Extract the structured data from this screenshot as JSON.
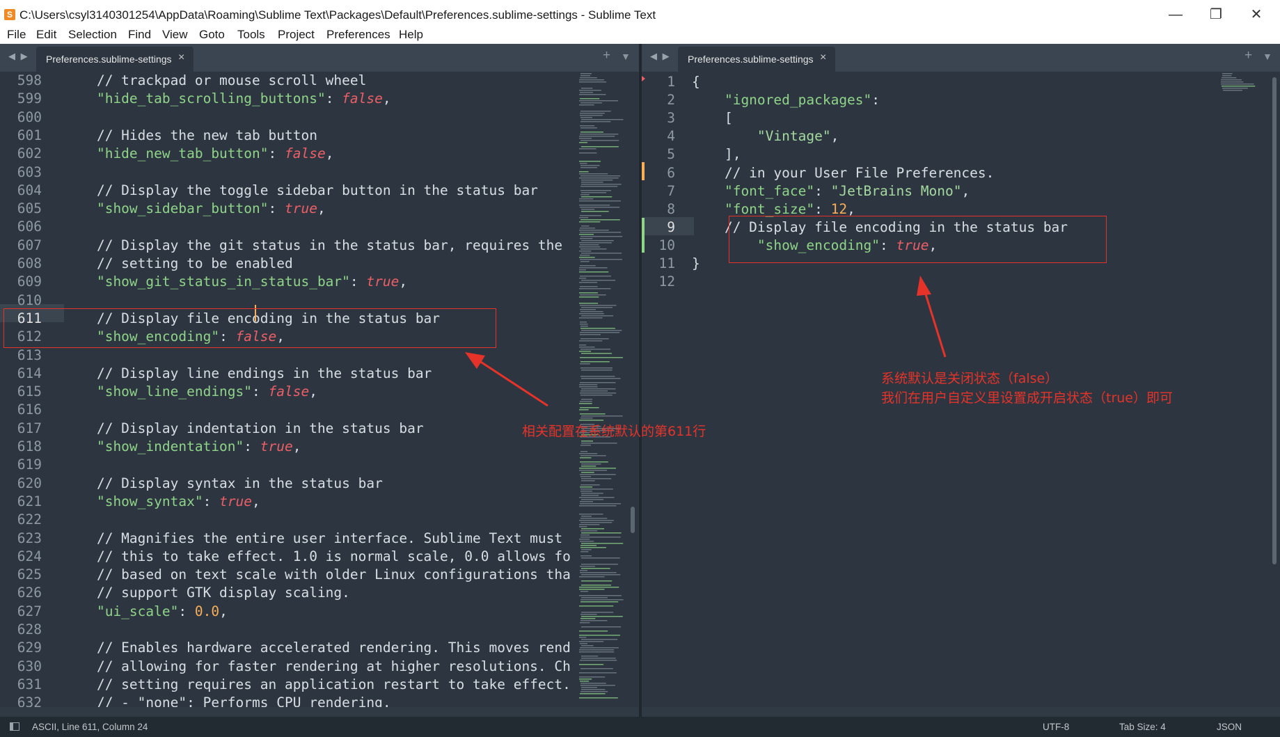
{
  "window": {
    "title": "C:\\Users\\csyl3140301254\\AppData\\Roaming\\Sublime Text\\Packages\\Default\\Preferences.sublime-settings - Sublime Text",
    "minimize": "—",
    "restore": "❐",
    "close": "✕"
  },
  "menu": [
    "File",
    "Edit",
    "Selection",
    "Find",
    "View",
    "Goto",
    "Tools",
    "Project",
    "Preferences",
    "Help"
  ],
  "left_pane": {
    "tab_label": "Preferences.sublime-settings",
    "lines": [
      {
        "num": "598",
        "tokens": [
          {
            "t": "    // trackpad or mouse scroll wheel",
            "c": "c"
          }
        ]
      },
      {
        "num": "599",
        "tokens": [
          {
            "t": "    \"hide_tab_scrolling_buttons\"",
            "c": "k"
          },
          {
            "t": ": ",
            "c": "c"
          },
          {
            "t": "false",
            "c": "b"
          },
          {
            "t": ",",
            "c": "c"
          }
        ]
      },
      {
        "num": "600",
        "tokens": []
      },
      {
        "num": "601",
        "tokens": [
          {
            "t": "    // Hides the new tab button",
            "c": "c"
          }
        ]
      },
      {
        "num": "602",
        "tokens": [
          {
            "t": "    \"hide_new_tab_button\"",
            "c": "k"
          },
          {
            "t": ": ",
            "c": "c"
          },
          {
            "t": "false",
            "c": "b"
          },
          {
            "t": ",",
            "c": "c"
          }
        ]
      },
      {
        "num": "603",
        "tokens": []
      },
      {
        "num": "604",
        "tokens": [
          {
            "t": "    // Display the toggle sidebar button in the status bar",
            "c": "c"
          }
        ]
      },
      {
        "num": "605",
        "tokens": [
          {
            "t": "    \"show_sidebar_button\"",
            "c": "k"
          },
          {
            "t": ": ",
            "c": "c"
          },
          {
            "t": "true",
            "c": "b"
          },
          {
            "t": ",",
            "c": "c"
          }
        ]
      },
      {
        "num": "606",
        "tokens": []
      },
      {
        "num": "607",
        "tokens": [
          {
            "t": "    // Display the git status in the status bar, requires the",
            "c": "c"
          }
        ]
      },
      {
        "num": "608",
        "tokens": [
          {
            "t": "    // setting to be enabled",
            "c": "c"
          }
        ]
      },
      {
        "num": "609",
        "tokens": [
          {
            "t": "    \"show_git_status_in_status_bar\"",
            "c": "k"
          },
          {
            "t": ": ",
            "c": "c"
          },
          {
            "t": "true",
            "c": "b"
          },
          {
            "t": ",",
            "c": "c"
          }
        ]
      },
      {
        "num": "610",
        "tokens": []
      },
      {
        "num": "611",
        "tokens": [
          {
            "t": "    // Display file encoding in the status bar",
            "c": "c"
          }
        ]
      },
      {
        "num": "612",
        "tokens": [
          {
            "t": "    \"show_encoding\"",
            "c": "k"
          },
          {
            "t": ": ",
            "c": "c"
          },
          {
            "t": "false",
            "c": "b"
          },
          {
            "t": ",",
            "c": "c"
          }
        ]
      },
      {
        "num": "613",
        "tokens": []
      },
      {
        "num": "614",
        "tokens": [
          {
            "t": "    // Display line endings in the status bar",
            "c": "c"
          }
        ]
      },
      {
        "num": "615",
        "tokens": [
          {
            "t": "    \"show_line_endings\"",
            "c": "k"
          },
          {
            "t": ": ",
            "c": "c"
          },
          {
            "t": "false",
            "c": "b"
          },
          {
            "t": ",",
            "c": "c"
          }
        ]
      },
      {
        "num": "616",
        "tokens": []
      },
      {
        "num": "617",
        "tokens": [
          {
            "t": "    // Display indentation in the status bar",
            "c": "c"
          }
        ]
      },
      {
        "num": "618",
        "tokens": [
          {
            "t": "    \"show_indentation\"",
            "c": "k"
          },
          {
            "t": ": ",
            "c": "c"
          },
          {
            "t": "true",
            "c": "b"
          },
          {
            "t": ",",
            "c": "c"
          }
        ]
      },
      {
        "num": "619",
        "tokens": []
      },
      {
        "num": "620",
        "tokens": [
          {
            "t": "    // Display syntax in the status bar",
            "c": "c"
          }
        ]
      },
      {
        "num": "621",
        "tokens": [
          {
            "t": "    \"show_syntax\"",
            "c": "k"
          },
          {
            "t": ": ",
            "c": "c"
          },
          {
            "t": "true",
            "c": "b"
          },
          {
            "t": ",",
            "c": "c"
          }
        ]
      },
      {
        "num": "622",
        "tokens": []
      },
      {
        "num": "623",
        "tokens": [
          {
            "t": "    // Magnifies the entire user interface. Sublime Text must",
            "c": "c"
          }
        ]
      },
      {
        "num": "624",
        "tokens": [
          {
            "t": "    // this to take effect. 1.0 is normal scale, 0.0 allows fo",
            "c": "c"
          }
        ]
      },
      {
        "num": "625",
        "tokens": [
          {
            "t": "    // based on text scale with older Linux configurations tha",
            "c": "c"
          }
        ]
      },
      {
        "num": "626",
        "tokens": [
          {
            "t": "    // support GTK display scaling.",
            "c": "c"
          }
        ]
      },
      {
        "num": "627",
        "tokens": [
          {
            "t": "    \"ui_scale\"",
            "c": "k"
          },
          {
            "t": ": ",
            "c": "c"
          },
          {
            "t": "0.0",
            "c": "n"
          },
          {
            "t": ",",
            "c": "c"
          }
        ]
      },
      {
        "num": "628",
        "tokens": []
      },
      {
        "num": "629",
        "tokens": [
          {
            "t": "    // Enables hardware accelerated rendering. This moves rend",
            "c": "c"
          }
        ]
      },
      {
        "num": "630",
        "tokens": [
          {
            "t": "    // allowing for faster rendering at higher resolutions. Ch",
            "c": "c"
          }
        ]
      },
      {
        "num": "631",
        "tokens": [
          {
            "t": "    // setting requires an application restart to take effect.",
            "c": "c"
          }
        ]
      },
      {
        "num": "632",
        "tokens": [
          {
            "t": "    // - \"none\": Performs CPU rendering.",
            "c": "c"
          }
        ]
      }
    ],
    "annotation": "相关配置在系统默认的第611行"
  },
  "right_pane": {
    "tab_label": "Preferences.sublime-settings",
    "lines": [
      {
        "num": "1",
        "tokens": [
          {
            "t": "{",
            "c": "c"
          }
        ]
      },
      {
        "num": "2",
        "tokens": [
          {
            "t": "    \"ignored_packages\"",
            "c": "k"
          },
          {
            "t": ":",
            "c": "c"
          }
        ]
      },
      {
        "num": "3",
        "tokens": [
          {
            "t": "    [",
            "c": "c"
          }
        ]
      },
      {
        "num": "4",
        "tokens": [
          {
            "t": "        \"Vintage\"",
            "c": "s"
          },
          {
            "t": ",",
            "c": "c"
          }
        ]
      },
      {
        "num": "5",
        "tokens": [
          {
            "t": "    ],",
            "c": "c"
          }
        ]
      },
      {
        "num": "6",
        "tokens": [
          {
            "t": "    // in your User File Preferences.",
            "c": "c"
          }
        ]
      },
      {
        "num": "7",
        "tokens": [
          {
            "t": "    \"font_face\"",
            "c": "k"
          },
          {
            "t": ": ",
            "c": "c"
          },
          {
            "t": "\"JetBrains Mono\"",
            "c": "s"
          },
          {
            "t": ",",
            "c": "c"
          }
        ]
      },
      {
        "num": "8",
        "tokens": [
          {
            "t": "    \"font_size\"",
            "c": "k"
          },
          {
            "t": ": ",
            "c": "c"
          },
          {
            "t": "12",
            "c": "n"
          },
          {
            "t": ",",
            "c": "c"
          }
        ]
      },
      {
        "num": "9",
        "tokens": [
          {
            "t": "    // Display file encoding in the status bar",
            "c": "c"
          }
        ]
      },
      {
        "num": "10",
        "tokens": [
          {
            "t": "        \"show_encoding\"",
            "c": "k"
          },
          {
            "t": ": ",
            "c": "c"
          },
          {
            "t": "true",
            "c": "b"
          },
          {
            "t": ",",
            "c": "c"
          }
        ]
      },
      {
        "num": "11",
        "tokens": [
          {
            "t": "}",
            "c": "c"
          }
        ]
      },
      {
        "num": "12",
        "tokens": []
      }
    ],
    "annotation_line1": "系统默认是关闭状态（false）",
    "annotation_line2": "我们在用户自定义里设置成开启状态（true）即可"
  },
  "status": {
    "position": "ASCII, Line 611, Column 24",
    "encoding": "UTF-8",
    "tab_size": "Tab Size: 4",
    "syntax": "JSON"
  },
  "colors": {
    "background": "#2d3640",
    "annotation": "#e5332a",
    "key": "#8fd488",
    "boolean": "#ec5f67",
    "number": "#f9ae58"
  }
}
